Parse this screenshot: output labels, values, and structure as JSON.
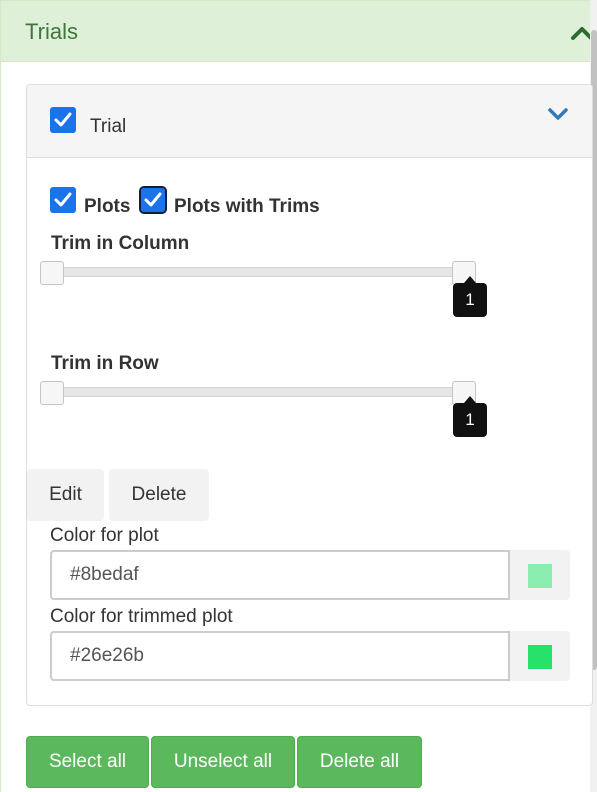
{
  "panel": {
    "title": "Trials",
    "collapse_icon": "chevron-up-icon"
  },
  "trial": {
    "label": "Trial",
    "checked": true,
    "expand_icon": "chevron-down-icon",
    "plots_label": "Plots",
    "plots_checked": true,
    "plots_with_trims_label": "Plots with Trims",
    "plots_with_trims_checked": true,
    "trim_column": {
      "label": "Trim in Column",
      "value": "1"
    },
    "trim_row": {
      "label": "Trim in Row",
      "value": "1"
    },
    "edit_label": "Edit",
    "delete_label": "Delete",
    "color_plot": {
      "label": "Color for plot",
      "value": "#8bedaf",
      "swatch": "#8bedaf"
    },
    "color_trimmed": {
      "label": "Color for trimmed plot",
      "value": "#26e26b",
      "swatch": "#26e26b"
    }
  },
  "actions": {
    "select_all": "Select all",
    "unselect_all": "Unselect all",
    "delete_all": "Delete all"
  },
  "colors": {
    "accent_green": "#5cb85c",
    "heading_green": "#dff0d8",
    "checkbox_blue": "#1a73e8"
  }
}
